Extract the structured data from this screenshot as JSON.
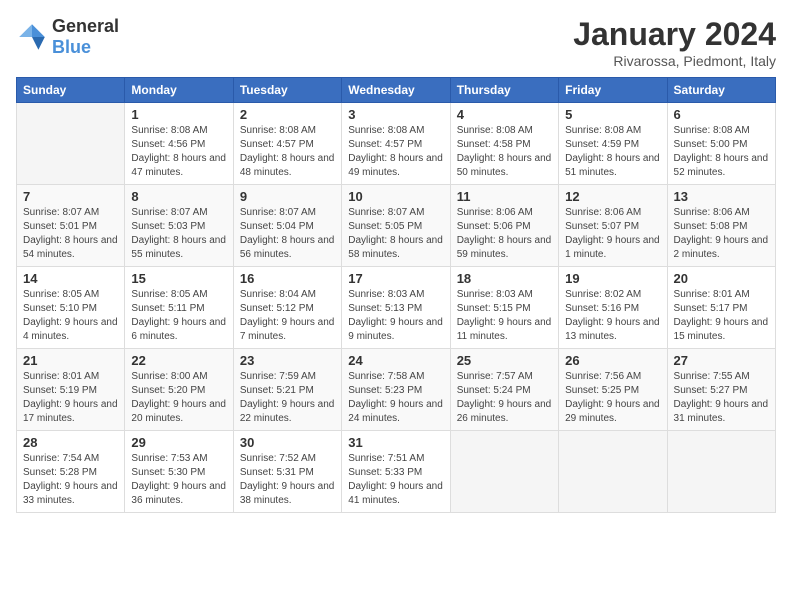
{
  "logo": {
    "general": "General",
    "blue": "Blue"
  },
  "header": {
    "month_title": "January 2024",
    "subtitle": "Rivarossa, Piedmont, Italy"
  },
  "days_of_week": [
    "Sunday",
    "Monday",
    "Tuesday",
    "Wednesday",
    "Thursday",
    "Friday",
    "Saturday"
  ],
  "weeks": [
    [
      {
        "day": "",
        "sunrise": "",
        "sunset": "",
        "daylight": ""
      },
      {
        "day": "1",
        "sunrise": "Sunrise: 8:08 AM",
        "sunset": "Sunset: 4:56 PM",
        "daylight": "Daylight: 8 hours and 47 minutes."
      },
      {
        "day": "2",
        "sunrise": "Sunrise: 8:08 AM",
        "sunset": "Sunset: 4:57 PM",
        "daylight": "Daylight: 8 hours and 48 minutes."
      },
      {
        "day": "3",
        "sunrise": "Sunrise: 8:08 AM",
        "sunset": "Sunset: 4:57 PM",
        "daylight": "Daylight: 8 hours and 49 minutes."
      },
      {
        "day": "4",
        "sunrise": "Sunrise: 8:08 AM",
        "sunset": "Sunset: 4:58 PM",
        "daylight": "Daylight: 8 hours and 50 minutes."
      },
      {
        "day": "5",
        "sunrise": "Sunrise: 8:08 AM",
        "sunset": "Sunset: 4:59 PM",
        "daylight": "Daylight: 8 hours and 51 minutes."
      },
      {
        "day": "6",
        "sunrise": "Sunrise: 8:08 AM",
        "sunset": "Sunset: 5:00 PM",
        "daylight": "Daylight: 8 hours and 52 minutes."
      }
    ],
    [
      {
        "day": "7",
        "sunrise": "Sunrise: 8:07 AM",
        "sunset": "Sunset: 5:01 PM",
        "daylight": "Daylight: 8 hours and 54 minutes."
      },
      {
        "day": "8",
        "sunrise": "Sunrise: 8:07 AM",
        "sunset": "Sunset: 5:03 PM",
        "daylight": "Daylight: 8 hours and 55 minutes."
      },
      {
        "day": "9",
        "sunrise": "Sunrise: 8:07 AM",
        "sunset": "Sunset: 5:04 PM",
        "daylight": "Daylight: 8 hours and 56 minutes."
      },
      {
        "day": "10",
        "sunrise": "Sunrise: 8:07 AM",
        "sunset": "Sunset: 5:05 PM",
        "daylight": "Daylight: 8 hours and 58 minutes."
      },
      {
        "day": "11",
        "sunrise": "Sunrise: 8:06 AM",
        "sunset": "Sunset: 5:06 PM",
        "daylight": "Daylight: 8 hours and 59 minutes."
      },
      {
        "day": "12",
        "sunrise": "Sunrise: 8:06 AM",
        "sunset": "Sunset: 5:07 PM",
        "daylight": "Daylight: 9 hours and 1 minute."
      },
      {
        "day": "13",
        "sunrise": "Sunrise: 8:06 AM",
        "sunset": "Sunset: 5:08 PM",
        "daylight": "Daylight: 9 hours and 2 minutes."
      }
    ],
    [
      {
        "day": "14",
        "sunrise": "Sunrise: 8:05 AM",
        "sunset": "Sunset: 5:10 PM",
        "daylight": "Daylight: 9 hours and 4 minutes."
      },
      {
        "day": "15",
        "sunrise": "Sunrise: 8:05 AM",
        "sunset": "Sunset: 5:11 PM",
        "daylight": "Daylight: 9 hours and 6 minutes."
      },
      {
        "day": "16",
        "sunrise": "Sunrise: 8:04 AM",
        "sunset": "Sunset: 5:12 PM",
        "daylight": "Daylight: 9 hours and 7 minutes."
      },
      {
        "day": "17",
        "sunrise": "Sunrise: 8:03 AM",
        "sunset": "Sunset: 5:13 PM",
        "daylight": "Daylight: 9 hours and 9 minutes."
      },
      {
        "day": "18",
        "sunrise": "Sunrise: 8:03 AM",
        "sunset": "Sunset: 5:15 PM",
        "daylight": "Daylight: 9 hours and 11 minutes."
      },
      {
        "day": "19",
        "sunrise": "Sunrise: 8:02 AM",
        "sunset": "Sunset: 5:16 PM",
        "daylight": "Daylight: 9 hours and 13 minutes."
      },
      {
        "day": "20",
        "sunrise": "Sunrise: 8:01 AM",
        "sunset": "Sunset: 5:17 PM",
        "daylight": "Daylight: 9 hours and 15 minutes."
      }
    ],
    [
      {
        "day": "21",
        "sunrise": "Sunrise: 8:01 AM",
        "sunset": "Sunset: 5:19 PM",
        "daylight": "Daylight: 9 hours and 17 minutes."
      },
      {
        "day": "22",
        "sunrise": "Sunrise: 8:00 AM",
        "sunset": "Sunset: 5:20 PM",
        "daylight": "Daylight: 9 hours and 20 minutes."
      },
      {
        "day": "23",
        "sunrise": "Sunrise: 7:59 AM",
        "sunset": "Sunset: 5:21 PM",
        "daylight": "Daylight: 9 hours and 22 minutes."
      },
      {
        "day": "24",
        "sunrise": "Sunrise: 7:58 AM",
        "sunset": "Sunset: 5:23 PM",
        "daylight": "Daylight: 9 hours and 24 minutes."
      },
      {
        "day": "25",
        "sunrise": "Sunrise: 7:57 AM",
        "sunset": "Sunset: 5:24 PM",
        "daylight": "Daylight: 9 hours and 26 minutes."
      },
      {
        "day": "26",
        "sunrise": "Sunrise: 7:56 AM",
        "sunset": "Sunset: 5:25 PM",
        "daylight": "Daylight: 9 hours and 29 minutes."
      },
      {
        "day": "27",
        "sunrise": "Sunrise: 7:55 AM",
        "sunset": "Sunset: 5:27 PM",
        "daylight": "Daylight: 9 hours and 31 minutes."
      }
    ],
    [
      {
        "day": "28",
        "sunrise": "Sunrise: 7:54 AM",
        "sunset": "Sunset: 5:28 PM",
        "daylight": "Daylight: 9 hours and 33 minutes."
      },
      {
        "day": "29",
        "sunrise": "Sunrise: 7:53 AM",
        "sunset": "Sunset: 5:30 PM",
        "daylight": "Daylight: 9 hours and 36 minutes."
      },
      {
        "day": "30",
        "sunrise": "Sunrise: 7:52 AM",
        "sunset": "Sunset: 5:31 PM",
        "daylight": "Daylight: 9 hours and 38 minutes."
      },
      {
        "day": "31",
        "sunrise": "Sunrise: 7:51 AM",
        "sunset": "Sunset: 5:33 PM",
        "daylight": "Daylight: 9 hours and 41 minutes."
      },
      {
        "day": "",
        "sunrise": "",
        "sunset": "",
        "daylight": ""
      },
      {
        "day": "",
        "sunrise": "",
        "sunset": "",
        "daylight": ""
      },
      {
        "day": "",
        "sunrise": "",
        "sunset": "",
        "daylight": ""
      }
    ]
  ]
}
